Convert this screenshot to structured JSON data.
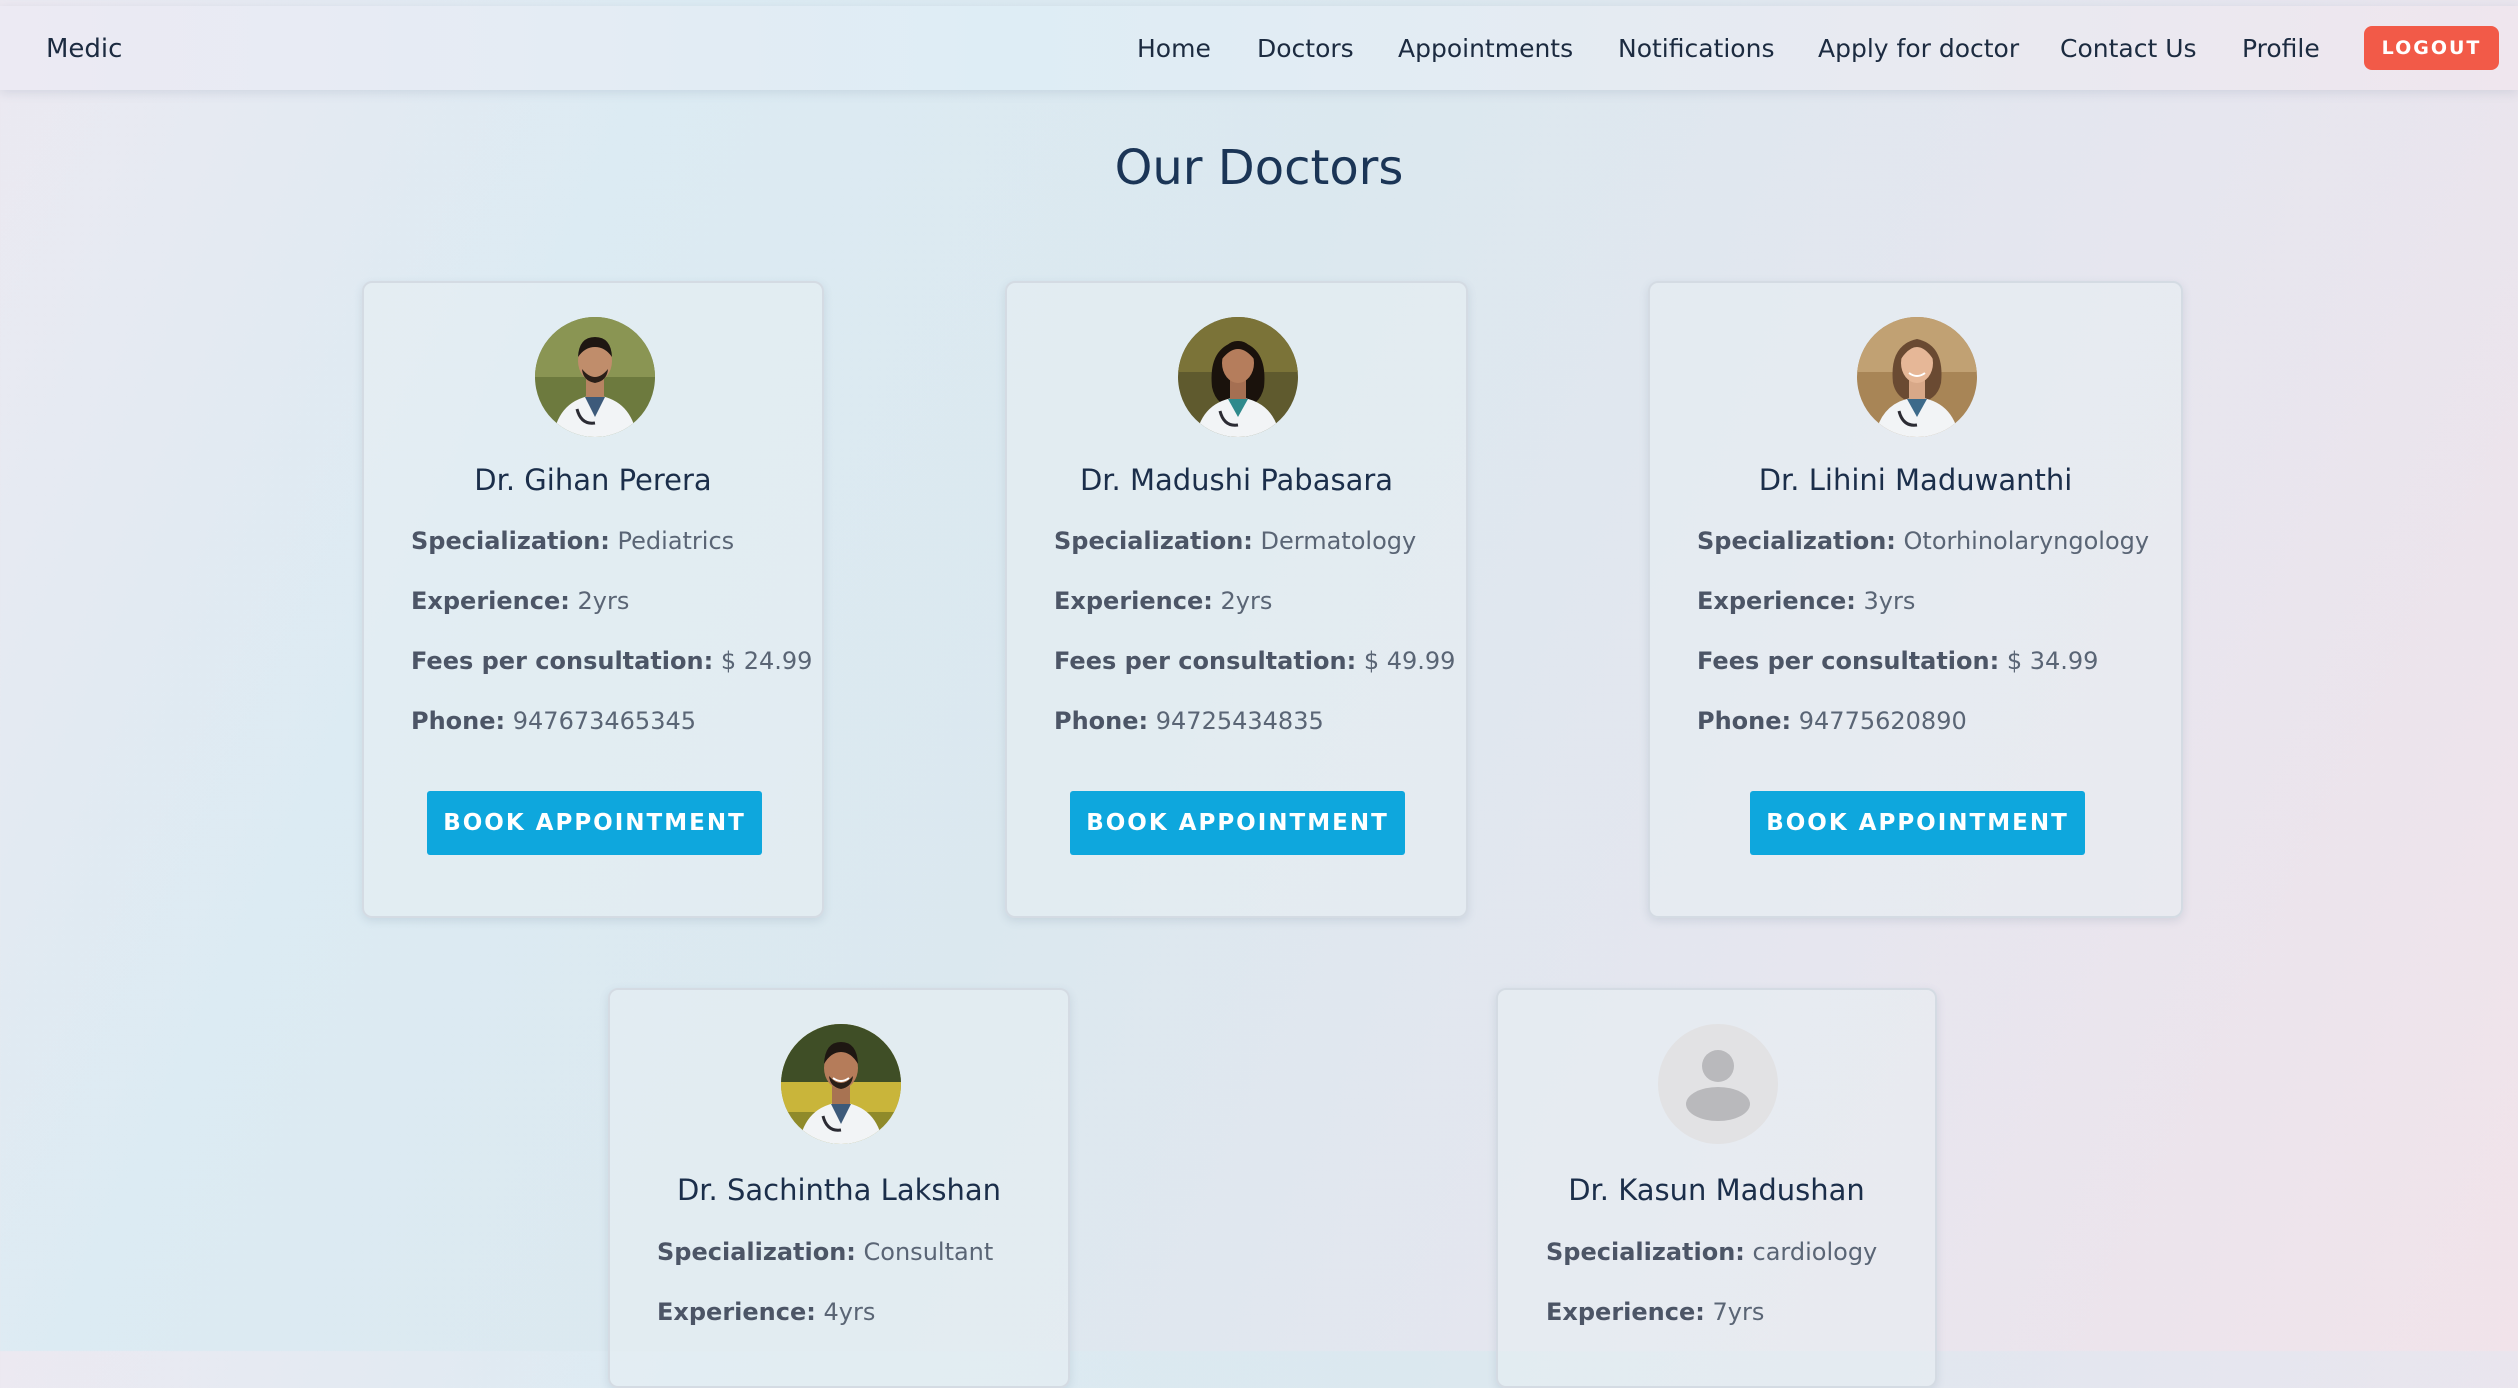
{
  "nav": {
    "brand": "Medic",
    "links": [
      "Home",
      "Doctors",
      "Appointments",
      "Notifications",
      "Apply for doctor",
      "Contact Us",
      "Profile"
    ],
    "logout_label": "LOGOUT"
  },
  "colors": {
    "logout": "#f25a48",
    "book_button": "#0ea7dd",
    "title": "#1b3556"
  },
  "page": {
    "title": "Our Doctors"
  },
  "labels": {
    "specialization": "Specialization:",
    "experience": "Experience:",
    "fees": "Fees per consultation:",
    "phone": "Phone:",
    "book": "BOOK APPOINTMENT"
  },
  "doctors": [
    {
      "name": "Dr. Gihan Perera",
      "specialization": "Pediatrics",
      "experience": "2yrs",
      "fees": "$ 24.99",
      "phone": "947673465345",
      "avatar": "doctor-photo-male"
    },
    {
      "name": "Dr. Madushi Pabasara",
      "specialization": "Dermatology",
      "experience": "2yrs",
      "fees": "$ 49.99",
      "phone": "94725434835",
      "avatar": "doctor-photo-female"
    },
    {
      "name": "Dr. Lihini Maduwanthi",
      "specialization": "Otorhinolaryngology",
      "experience": "3yrs",
      "fees": "$ 34.99",
      "phone": "94775620890",
      "avatar": "doctor-photo-female"
    },
    {
      "name": "Dr. Sachintha Lakshan",
      "specialization": "Consultant",
      "experience": "4yrs",
      "avatar": "doctor-photo-male"
    },
    {
      "name": "Dr. Kasun Madushan",
      "specialization": "cardiology",
      "experience": "7yrs",
      "avatar": "default-user-icon"
    }
  ]
}
